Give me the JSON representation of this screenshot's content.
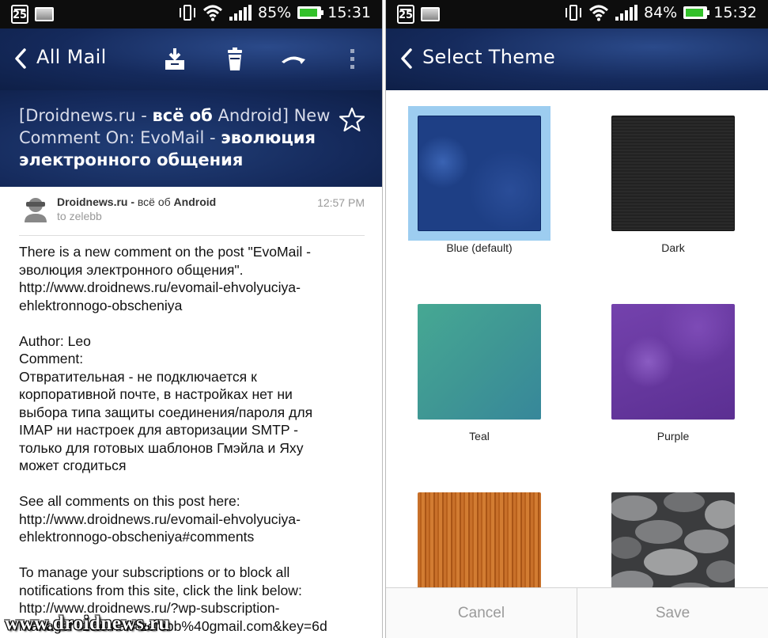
{
  "left_screen": {
    "status": {
      "date": "25",
      "battery": "85%",
      "battery_level": 0.85,
      "time": "15:31"
    },
    "appbar": {
      "title": "All Mail"
    },
    "subject": {
      "part1": "[Droidnews.ru - ",
      "bold1": "всё об",
      "part2": " Android] New Comment On: EvoMail - ",
      "bold2": "эволюция электронного общения"
    },
    "sender": {
      "name_bold": "Droidnews.ru - ",
      "name_regular": "всё об",
      "name_bold2": " Android",
      "to": "to zelebb",
      "time": "12:57 PM"
    },
    "body": {
      "p1": [
        "There is a new comment on the post \"EvoMail -",
        "эволюция электронного общения\".",
        "http://www.droidnews.ru/evomail-ehvolyuciya-",
        "ehlektronnogo-obscheniya"
      ],
      "p2": [
        "Author: Leo",
        "Comment:",
        "Отвратительная - не подключается к",
        "корпоративной почте, в настройках нет ни",
        "выбора типа защиты соединения/пароля для",
        "IMAP ни настроек для авторизации SMTP -",
        "только для готовых шаблонов Гмэйла и Яху",
        "может сгодиться"
      ],
      "p3": [
        "See all comments on this post here:",
        "http://www.droidnews.ru/evomail-ehvolyuciya-",
        "ehlektronnogo-obscheniya#comments"
      ],
      "p4": [
        "To manage your subscriptions or to block all",
        "notifications from this site, click the link below:",
        "http://www.droidnews.ru/?wp-subscription-",
        "manager=1&email=zelebb%40gmail.com&key=6d"
      ]
    },
    "watermark": "www.droidnews.ru"
  },
  "right_screen": {
    "status": {
      "date": "25",
      "battery": "84%",
      "battery_level": 0.84,
      "time": "15:32"
    },
    "appbar": {
      "title": "Select Theme"
    },
    "themes": [
      {
        "label": "Blue (default)",
        "selected": true,
        "color": "#1e3f85"
      },
      {
        "label": "Dark",
        "selected": false,
        "color": "#262626"
      },
      {
        "label": "Teal",
        "selected": false,
        "color": "#3f9794"
      },
      {
        "label": "Purple",
        "selected": false,
        "color": "#6a3a9f"
      },
      {
        "label": "",
        "selected": false,
        "color": "#c56a1f"
      },
      {
        "label": "",
        "selected": false,
        "color": "#77787a"
      }
    ],
    "buttons": {
      "cancel": "Cancel",
      "save": "Save"
    }
  },
  "colors": {
    "header_blue": "#152a5c",
    "selection_ring": "#9dcdf0",
    "battery_green": "#33c12a"
  },
  "icons": [
    "calendar-icon",
    "image-icon",
    "vibrate-icon",
    "wifi-icon",
    "signal-icon",
    "battery-icon",
    "back-arrow-icon",
    "archive-icon",
    "trash-icon",
    "reply-icon",
    "overflow-menu-icon",
    "star-icon",
    "avatar-icon"
  ]
}
